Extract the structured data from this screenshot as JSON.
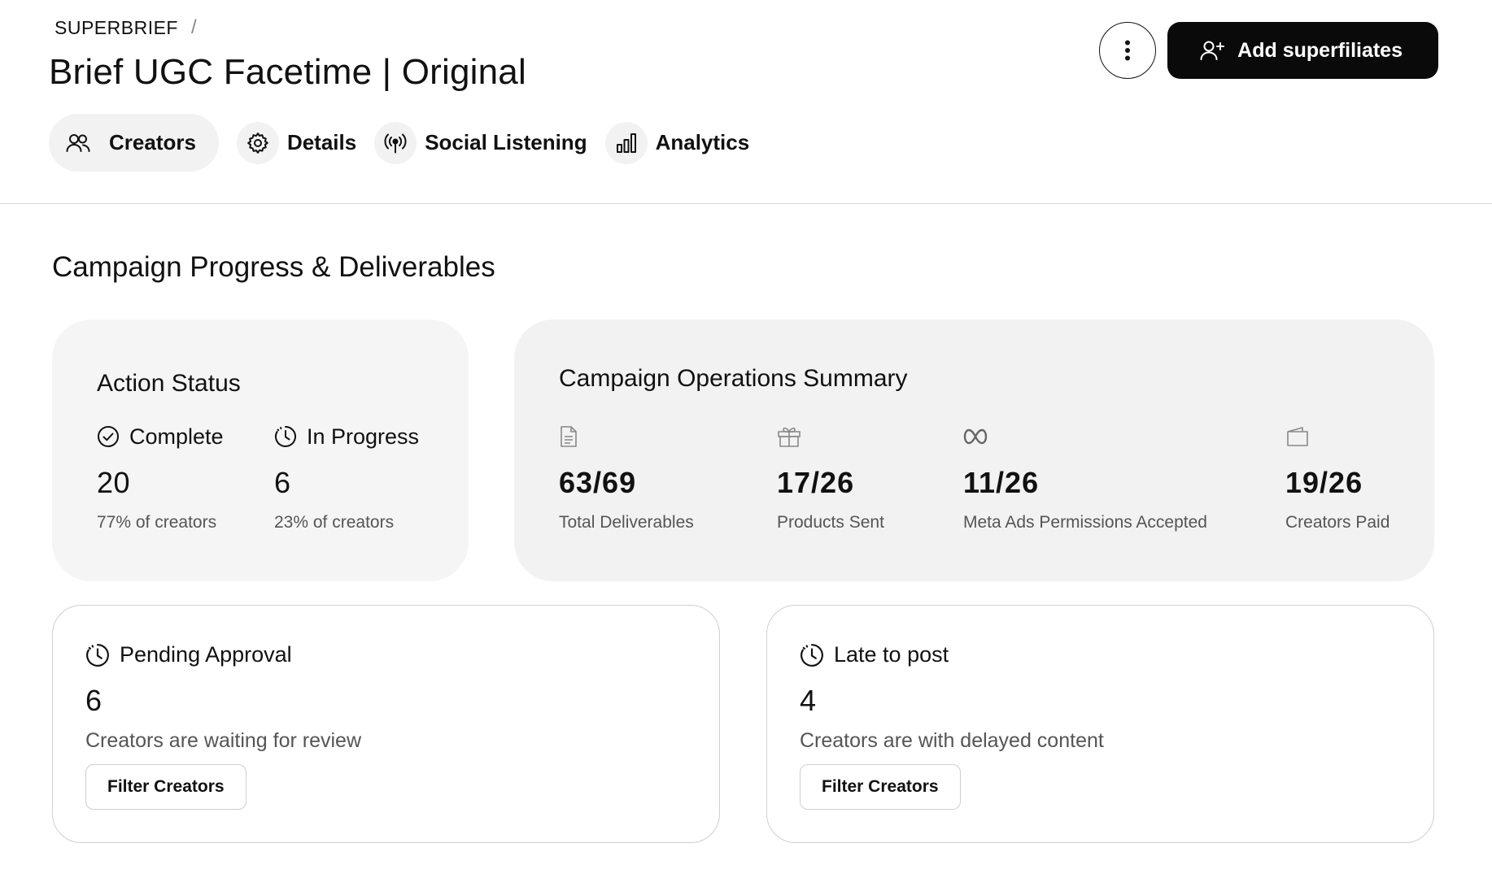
{
  "header": {
    "breadcrumb": "SUPERBRIEF",
    "breadcrumb_separator": "/",
    "title": "Brief UGC Facetime | Original",
    "more_icon": "more-vertical-icon",
    "add_button_label": "Add superfiliates",
    "add_button_icon": "user-plus-icon"
  },
  "tabs": [
    {
      "label": "Creators",
      "icon": "users-icon",
      "active": true
    },
    {
      "label": "Details",
      "icon": "gear-icon",
      "active": false
    },
    {
      "label": "Social Listening",
      "icon": "broadcast-icon",
      "active": false
    },
    {
      "label": "Analytics",
      "icon": "bar-chart-icon",
      "active": false
    }
  ],
  "main": {
    "section_title": "Campaign Progress & Deliverables",
    "action_status": {
      "title": "Action Status",
      "complete": {
        "label": "Complete",
        "value": "20",
        "sub": "77% of creators",
        "icon": "check-circle-icon"
      },
      "in_progress": {
        "label": "In Progress",
        "value": "6",
        "sub": "23% of creators",
        "icon": "clock-icon"
      }
    },
    "operations": {
      "title": "Campaign Operations Summary",
      "items": [
        {
          "value": "63/69",
          "label": "Total Deliverables",
          "icon": "document-icon"
        },
        {
          "value": "17/26",
          "label": "Products Sent",
          "icon": "gift-icon"
        },
        {
          "value": "11/26",
          "label": "Meta Ads Permissions Accepted",
          "icon": "meta-icon"
        },
        {
          "value": "19/26",
          "label": "Creators Paid",
          "icon": "wallet-icon"
        }
      ]
    },
    "pending": {
      "title": "Pending Approval",
      "value": "6",
      "description": "Creators are waiting for review",
      "button": "Filter Creators",
      "icon": "clock-icon"
    },
    "late": {
      "title": "Late to post",
      "value": "4",
      "description": "Creators are with delayed content",
      "button": "Filter Creators",
      "icon": "clock-icon"
    }
  },
  "colors": {
    "primary": "#0a0a0a",
    "card_bg": "#f5f5f5",
    "border": "#cfcfcf",
    "muted_text": "#555555"
  }
}
